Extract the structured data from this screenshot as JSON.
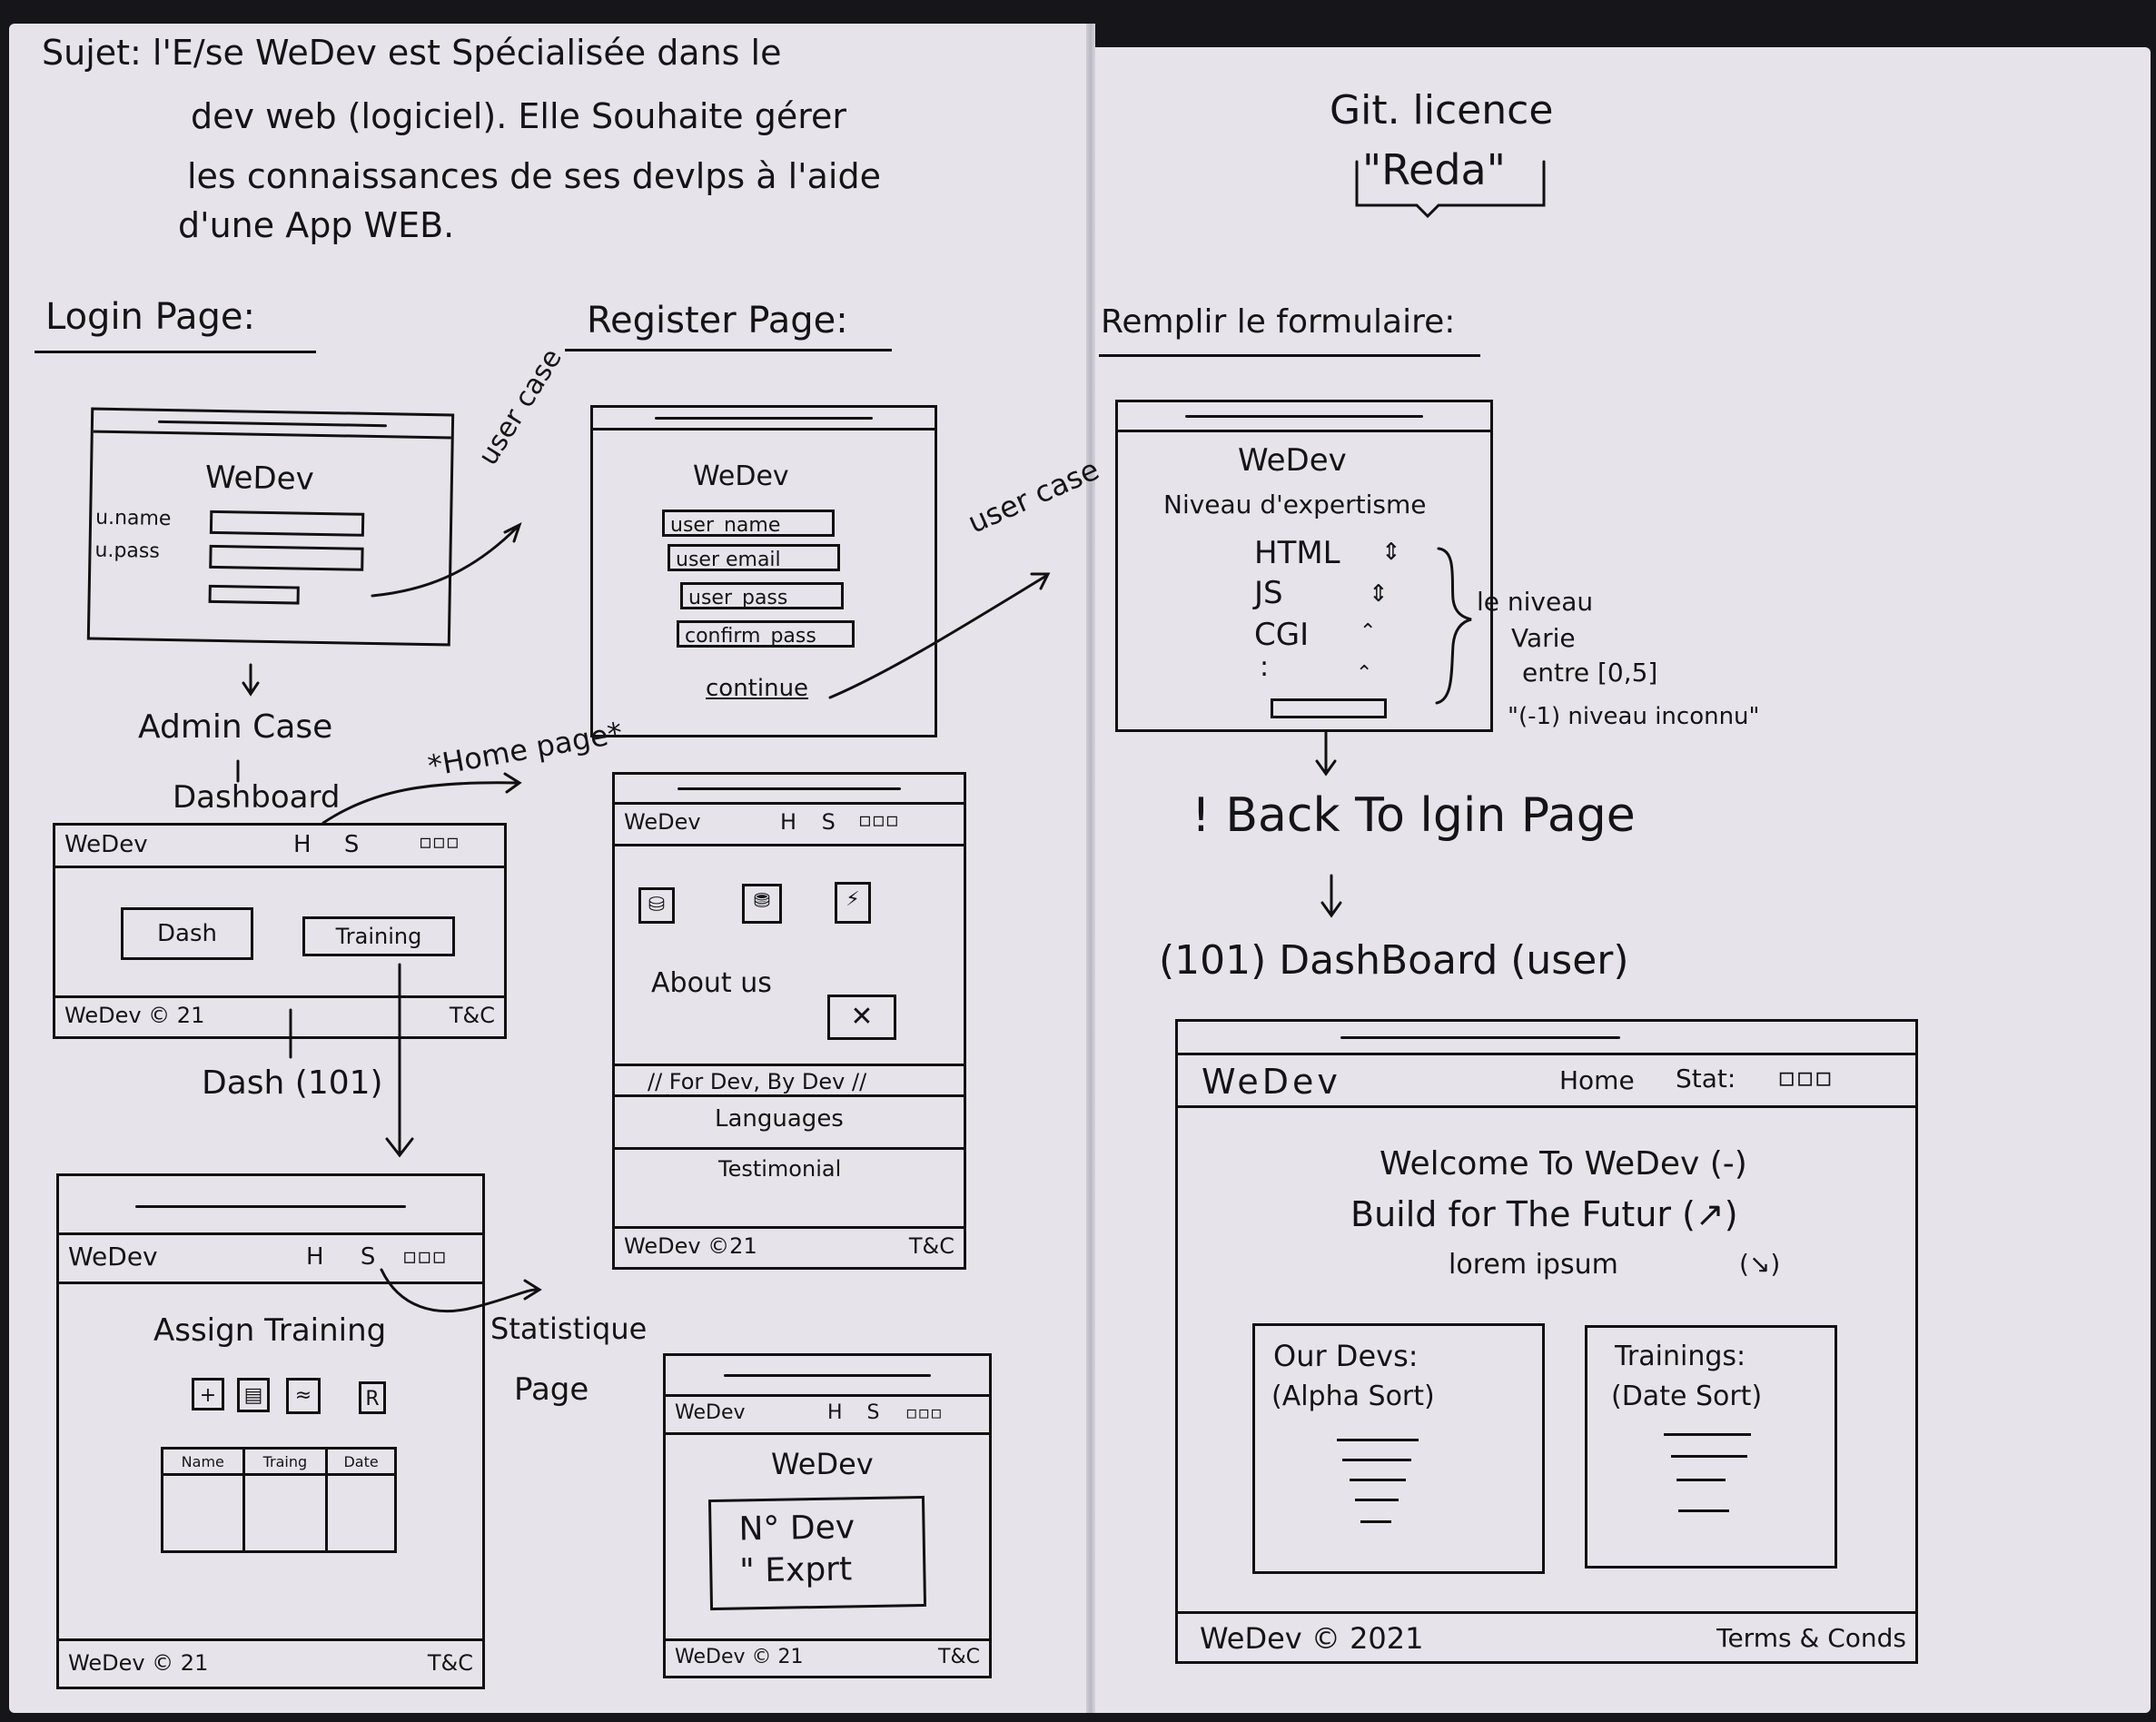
{
  "header": {
    "subject_lines": [
      "Sujet: l'E/se WeDev est Spécialisée dans le",
      "dev web (logiciel). Elle Souhaite gérer",
      "les connaissances de ses devlps à l'aide",
      "d'une App WEB."
    ],
    "git_line": "Git. licence",
    "git_name": "\"Reda\""
  },
  "sections": {
    "login": "Login Page:",
    "register": "Register Page:",
    "form": "Remplir le formulaire:"
  },
  "login_mock": {
    "brand": "WeDev",
    "user_label": "u.name",
    "pass_label": "u.pass",
    "note": "user case"
  },
  "register_mock": {
    "brand": "WeDev",
    "fields": [
      "user_name",
      "user email",
      "user_pass",
      "confirm_pass"
    ],
    "continue": "continue",
    "note": "user case"
  },
  "form_mock": {
    "brand": "WeDev",
    "heading": "Niveau d'expertisme",
    "skills": [
      "HTML",
      "JS",
      "CGI"
    ],
    "dots": ":",
    "note_lines": [
      "le niveau",
      "Varie",
      "entre [0,5]",
      "\"(-1) niveau inconnu\""
    ]
  },
  "flow": {
    "admin_case": "Admin Case",
    "dashboard": "Dashboard",
    "home_page": "*Home page*",
    "dash_101": "Dash (101)",
    "statistique_line1": "Statistique",
    "statistique_line2": "Page",
    "back_to_login": "! Back To lgin Page",
    "dashboard_user": "(101) DashBoard (user)"
  },
  "admin_dash": {
    "brand": "WeDev",
    "links": "H S",
    "win_icons": "▫▫▫",
    "dash_btn": "Dash",
    "training_btn": "Training",
    "footer_left": "WeDev © 21",
    "footer_right": "T&C"
  },
  "home_mock": {
    "brand": "WeDev",
    "links": "H S",
    "win_icons": "▫▫▫",
    "about": "About us",
    "rows": [
      "// For Dev, By Dev //",
      "Languages",
      "Testimonial"
    ],
    "footer_left": "WeDev ©21",
    "footer_right": "T&C"
  },
  "training_mock": {
    "brand": "WeDev",
    "links": "H S",
    "win_icons": "▫▫▫",
    "title": "Assign Training",
    "tools": [
      "+",
      "▤",
      "≈",
      "R"
    ],
    "table_headers": [
      "Name",
      "Traing",
      "Date"
    ],
    "footer_left": "WeDev © 21",
    "footer_right": "T&C"
  },
  "stats_mock": {
    "brand": "WeDev",
    "links": "H S",
    "win_icons": "▫▫▫",
    "title": "WeDev",
    "line1": "N° Dev",
    "line2": "\" Exprt",
    "footer_left": "WeDev © 21",
    "footer_right": "T&C"
  },
  "user_dash": {
    "brand": "WeDev",
    "home": "Home",
    "stat": "Stat:",
    "win_icons": "▫▫▫",
    "welcome": "Welcome To WeDev (-)",
    "build": "Build for The Futur (↗)",
    "lorem": "lorem ipsum",
    "lorem_tag": "(↘)",
    "card1_title": "Our Devs:",
    "card1_sub": "(Alpha Sort)",
    "card2_title": "Trainings:",
    "card2_sub": "(Date Sort)",
    "footer_left": "WeDev © 2021",
    "footer_right": "Terms & Conds"
  }
}
